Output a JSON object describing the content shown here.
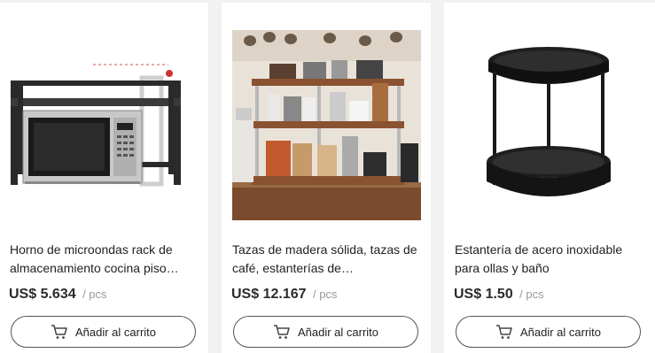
{
  "products": [
    {
      "title": "Horno de microondas rack de almacenamiento cocina piso…",
      "price": "US$ 5.634",
      "unit": "/ pcs",
      "cart_label": "Añadir al carrito",
      "image": "microwave-rack-image"
    },
    {
      "title": "Tazas de madera sólida, tazas de café, estanterías de…",
      "price": "US$ 12.167",
      "unit": "/ pcs",
      "cart_label": "Añadir al carrito",
      "image": "coffee-shelf-image"
    },
    {
      "title": "Estantería de acero inoxidable para ollas y baño",
      "price": "US$ 1.50",
      "unit": "/ pcs",
      "cart_label": "Añadir al carrito",
      "image": "steel-two-tier-rack-image"
    }
  ],
  "colors": {
    "card_bg": "#ffffff",
    "page_bg": "#f2f2f2",
    "price_text": "#2b2b2b",
    "unit_text": "#999999",
    "button_border": "#555555"
  }
}
